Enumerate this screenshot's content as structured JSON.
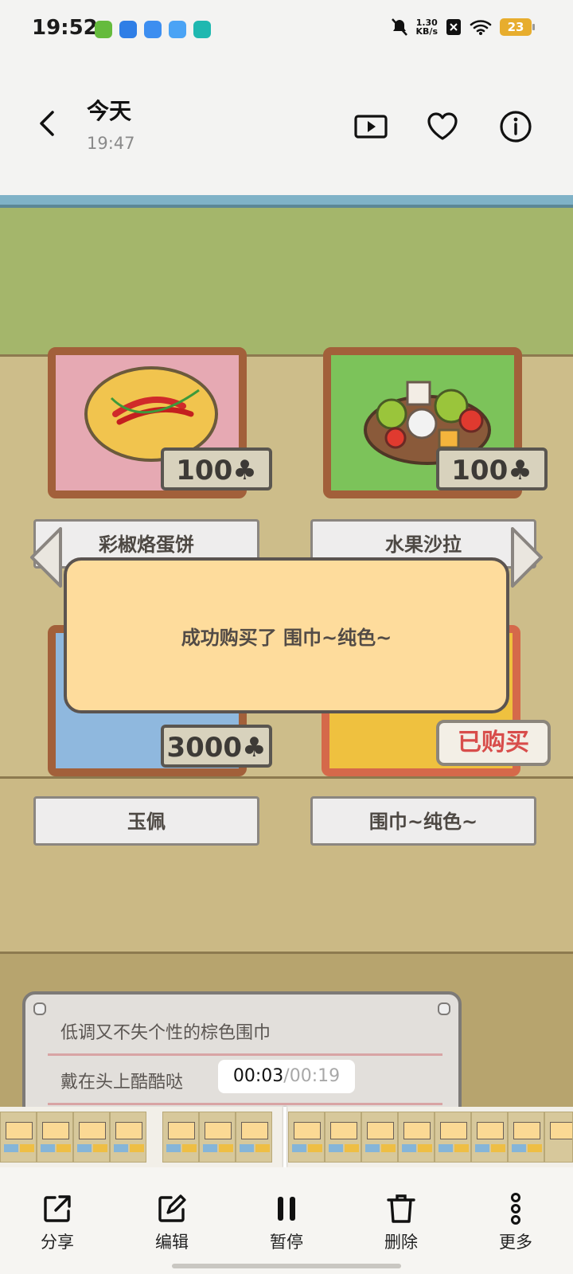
{
  "status_bar": {
    "time": "19:52",
    "net_speed_value": "1.30",
    "net_speed_unit": "KB/s",
    "battery": "23"
  },
  "header": {
    "title": "今天",
    "subtitle": "19:47",
    "icons": [
      "back-icon",
      "play-slideshow-icon",
      "heart-icon",
      "info-icon"
    ]
  },
  "game": {
    "items": [
      {
        "name": "彩椒烙蛋饼",
        "price": "100"
      },
      {
        "name": "水果沙拉",
        "price": "100"
      },
      {
        "name": "玉佩",
        "price": "3000"
      },
      {
        "name": "围巾~纯色~",
        "status": "已购买"
      }
    ],
    "toast": "成功购买了 围巾~纯色~",
    "description_lines": [
      "低调又不失个性的棕色围巾",
      "戴在头上酷酷哒"
    ],
    "currency_symbol": "♣"
  },
  "player": {
    "current_time": "00:03",
    "separator": "/",
    "total_time": "00:19"
  },
  "toolbar": {
    "share": "分享",
    "edit": "编辑",
    "pause": "暂停",
    "delete": "删除",
    "more": "更多"
  },
  "colors": {
    "toast_bg": "#fedc9c",
    "bought_text": "#d84d4b",
    "battery": "#e7ad2e",
    "wall": "#a4b66b"
  }
}
